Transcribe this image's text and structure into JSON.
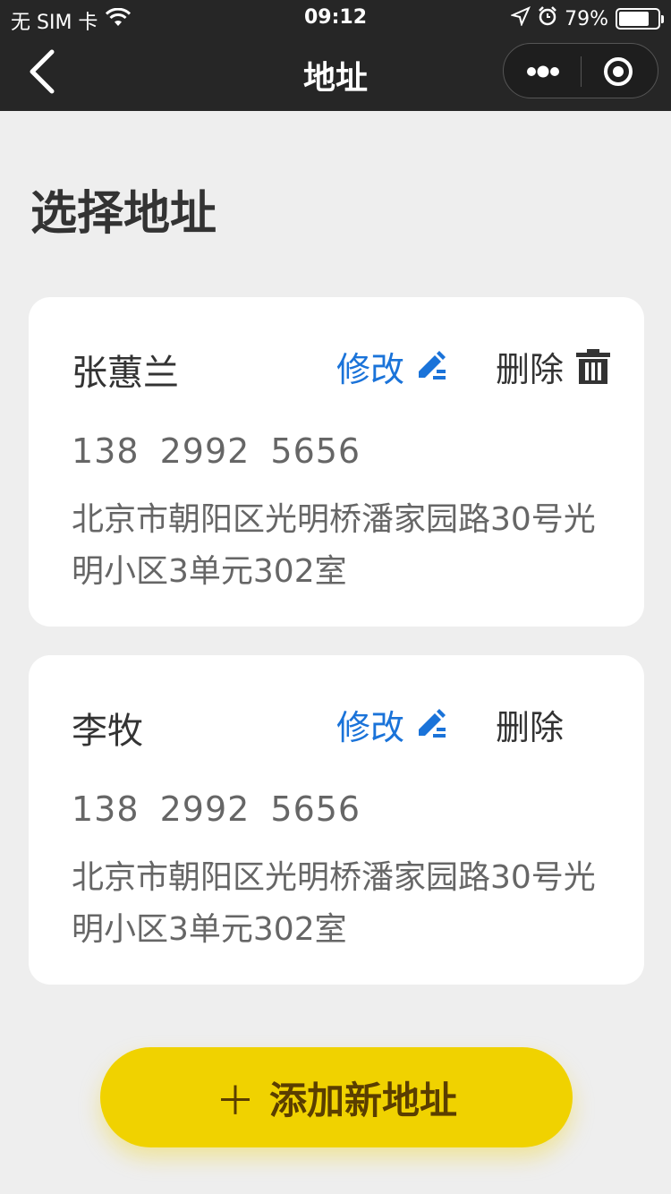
{
  "status_bar": {
    "carrier": "无 SIM 卡",
    "time": "09:12",
    "battery": "79%",
    "battery_level": 0.79
  },
  "nav": {
    "title": "地址"
  },
  "page": {
    "title": "选择地址"
  },
  "addresses": [
    {
      "name": "张蕙兰",
      "edit_label": "修改",
      "delete_label": "删除",
      "phone": "138 2992 5656",
      "address": "北京市朝阳区光明桥潘家园路30号光明小区3单元302室"
    },
    {
      "name": "李牧",
      "edit_label": "修改",
      "delete_label": "删除",
      "phone": "138 2992 5656",
      "address": "北京市朝阳区光明桥潘家园路30号光明小区3单元302室"
    }
  ],
  "add_button": {
    "plus": "＋",
    "label": "添加新地址"
  },
  "colors": {
    "accent_blue": "#1a73d9",
    "button_yellow": "#f0d200",
    "topbar": "#262626",
    "background": "#eeeeee"
  },
  "icons": {
    "back": "chevron-left-icon",
    "more": "more-dots-icon",
    "target": "record-circle-icon",
    "edit": "pencil-edit-icon",
    "delete": "trash-icon",
    "wifi": "wifi-icon",
    "location": "location-arrow-icon",
    "alarm": "alarm-clock-icon"
  }
}
